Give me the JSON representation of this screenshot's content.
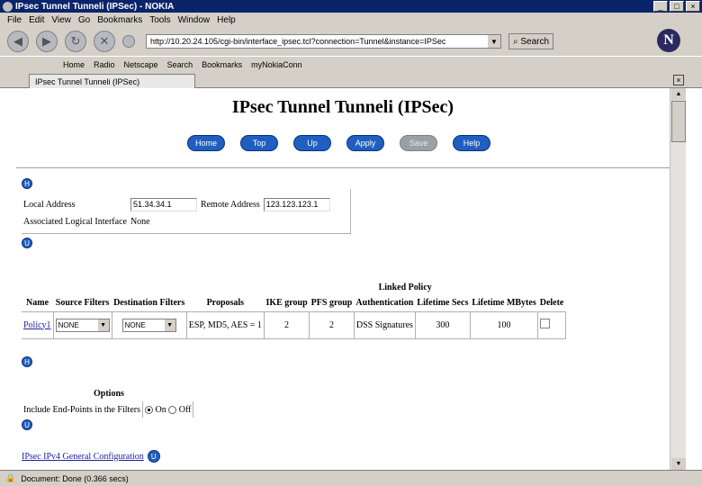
{
  "window": {
    "title": "IPsec Tunnel Tunneli (IPSec) - NOKIA",
    "minimize": "_",
    "maximize": "□",
    "close": "×"
  },
  "menu": [
    "File",
    "Edit",
    "View",
    "Go",
    "Bookmarks",
    "Tools",
    "Window",
    "Help"
  ],
  "nav": {
    "url": "http://10.20.24.105/cgi-bin/interface_ipsec.tcl?connection=Tunnel&instance=IPSec",
    "search_label": "Search",
    "logo": "N"
  },
  "personal_toolbar": [
    "Home",
    "Radio",
    "Netscape",
    "Search",
    "Bookmarks",
    "myNokiaConn"
  ],
  "tab": {
    "label": "IPsec Tunnel Tunneli (IPSec)",
    "close": "×"
  },
  "page": {
    "title": "IPsec Tunnel Tunneli (IPSec)",
    "buttons": {
      "home": "Home",
      "top": "Top",
      "up": "Up",
      "apply": "Apply",
      "save": "Save",
      "help": "Help"
    },
    "circle_h": "H",
    "circle_u": "U",
    "local_address_label": "Local Address",
    "local_address_value": "51.34.34.1",
    "remote_address_label": "Remote Address",
    "remote_address_value": "123.123.123.1",
    "logical_interface_label": "Associated Logical Interface",
    "logical_interface_value": "None",
    "linked_policy_heading": "Linked Policy",
    "policy_columns": [
      "Name",
      "Source Filters",
      "Destination Filters",
      "Proposals",
      "IKE group",
      "PFS group",
      "Authentication",
      "Lifetime Secs",
      "Lifetime MBytes",
      "Delete"
    ],
    "policy_row": {
      "name": "Policy1",
      "source_filter": "NONE",
      "destination_filter": "NONE",
      "proposals": "ESP, MD5, AES = 1",
      "ike_group": "2",
      "pfs_group": "2",
      "authentication": "DSS Signatures",
      "lifetime_secs": "300",
      "lifetime_mbytes": "100"
    },
    "options_heading": "Options",
    "include_endpoints_label": "Include End-Points in the Filters",
    "radio_on": "On",
    "radio_off": "Off",
    "general_config_link": "IPsec IPv4 General Configuration"
  },
  "status": {
    "text": "Document: Done (0.366 secs)"
  }
}
